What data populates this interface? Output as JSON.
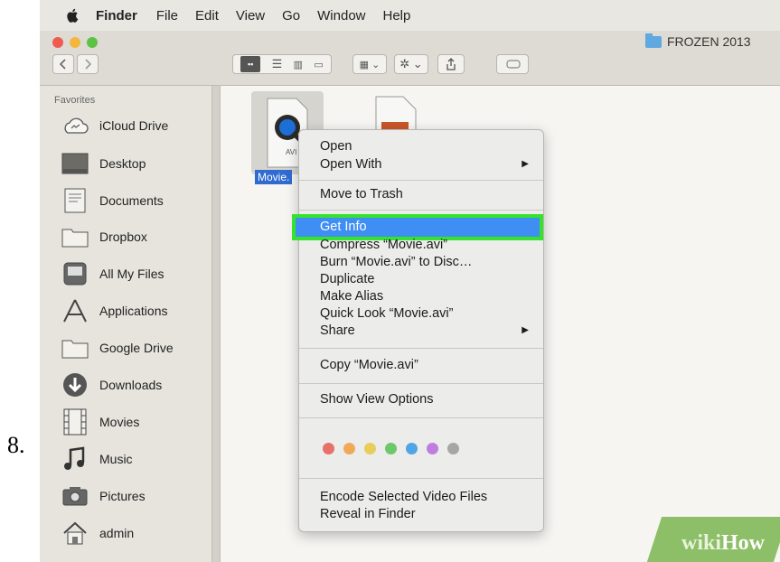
{
  "step_number": "8.",
  "menubar": {
    "app_name": "Finder",
    "items": [
      "File",
      "Edit",
      "View",
      "Go",
      "Window",
      "Help"
    ]
  },
  "window": {
    "title": "FROZEN 2013",
    "traffic_lights": [
      "#ef5b4f",
      "#f4b63d",
      "#5cc244"
    ]
  },
  "sidebar": {
    "header": "Favorites",
    "items": [
      {
        "label": "iCloud Drive",
        "icon": "cloud-icon"
      },
      {
        "label": "Desktop",
        "icon": "desktop-icon"
      },
      {
        "label": "Documents",
        "icon": "documents-icon"
      },
      {
        "label": "Dropbox",
        "icon": "folder-icon"
      },
      {
        "label": "All My Files",
        "icon": "all-files-icon"
      },
      {
        "label": "Applications",
        "icon": "applications-icon"
      },
      {
        "label": "Google Drive",
        "icon": "folder-icon"
      },
      {
        "label": "Downloads",
        "icon": "download-icon"
      },
      {
        "label": "Movies",
        "icon": "film-icon"
      },
      {
        "label": "Music",
        "icon": "music-icon"
      },
      {
        "label": "Pictures",
        "icon": "camera-icon"
      },
      {
        "label": "admin",
        "icon": "home-icon"
      }
    ]
  },
  "files": {
    "selected_label": "Movie.",
    "selected_badge": "AVI"
  },
  "context_menu": {
    "groups": [
      [
        "Open",
        "Open With"
      ],
      [
        "Move to Trash"
      ],
      [
        "Get Info",
        "Compress “Movie.avi”",
        "Burn “Movie.avi” to Disc…",
        "Duplicate",
        "Make Alias",
        "Quick Look “Movie.avi”",
        "Share"
      ],
      [
        "Copy “Movie.avi”"
      ],
      [
        "Show View Options"
      ],
      [
        "Encode Selected Video Files",
        "Reveal in Finder"
      ]
    ],
    "highlighted": "Get Info",
    "highlight_color": "#3f8ef3",
    "callout_color": "#35e32c",
    "tag_colors": [
      "#e8706a",
      "#efa957",
      "#e7cd5b",
      "#6cc86a",
      "#4fa5e6",
      "#c07de0",
      "#a6a6a6"
    ]
  },
  "watermark": {
    "part1": "wiki",
    "part2": "How"
  }
}
